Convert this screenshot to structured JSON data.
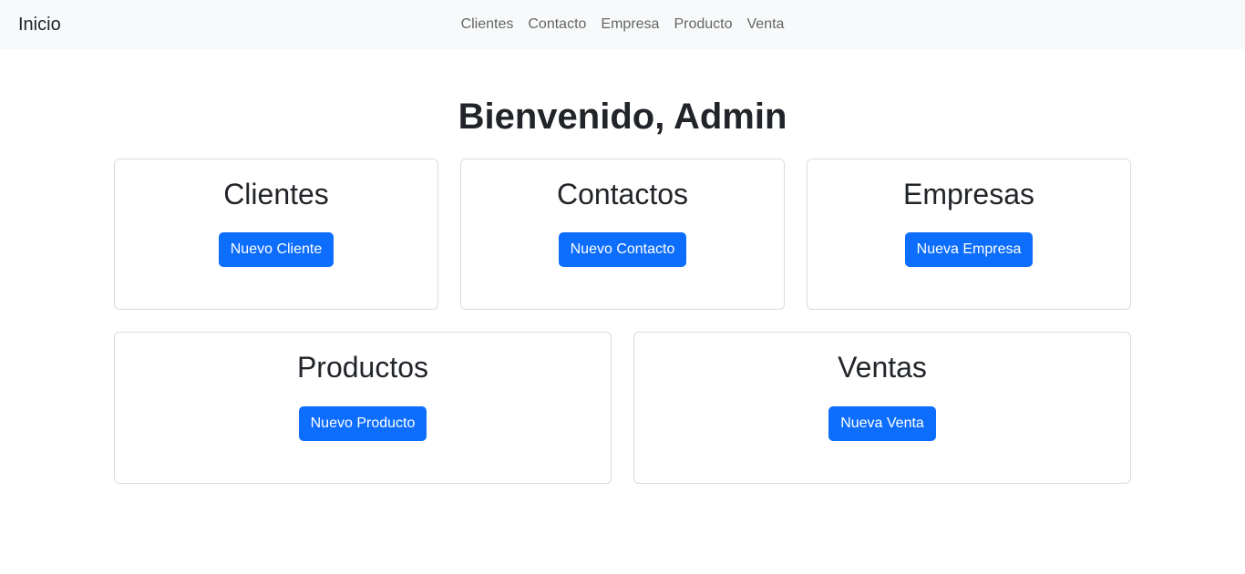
{
  "navbar": {
    "brand": "Inicio",
    "links": [
      "Clientes",
      "Contacto",
      "Empresa",
      "Producto",
      "Venta"
    ]
  },
  "main": {
    "title": "Bienvenido, Admin",
    "cards": [
      {
        "heading": "Clientes",
        "button": "Nuevo Cliente"
      },
      {
        "heading": "Contactos",
        "button": "Nuevo Contacto"
      },
      {
        "heading": "Empresas",
        "button": "Nueva Empresa"
      },
      {
        "heading": "Productos",
        "button": "Nuevo Producto"
      },
      {
        "heading": "Ventas",
        "button": "Nueva Venta"
      }
    ]
  },
  "colors": {
    "navbar_bg": "#f8f9fa",
    "primary": "#0d6efd",
    "text": "#212529",
    "nav_link": "#666666",
    "card_border": "#d9dcdf"
  }
}
